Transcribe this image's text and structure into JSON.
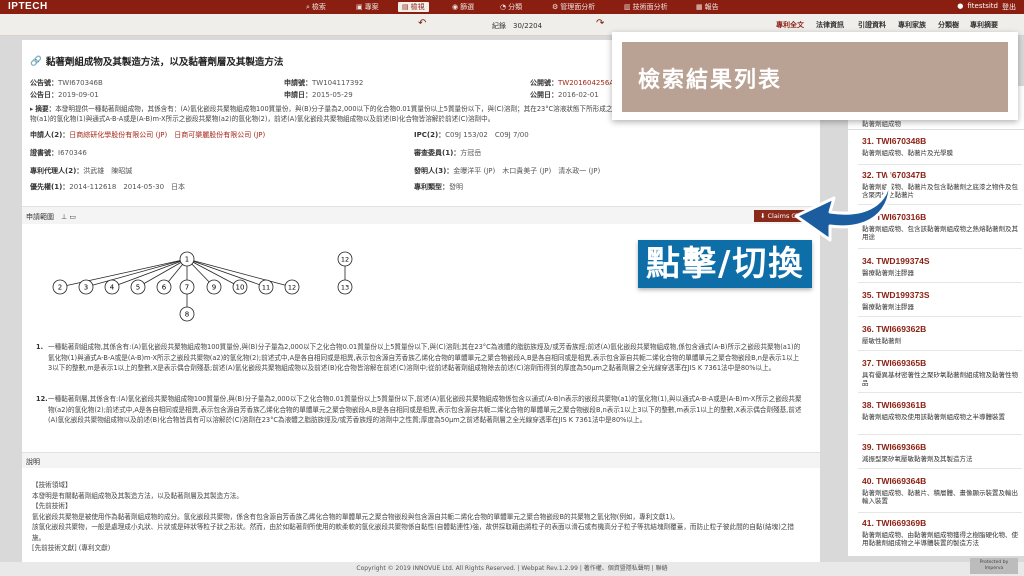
{
  "nav": {
    "logo": "IPTECH",
    "items": [
      {
        "icon": "search-icon",
        "label": "檢索"
      },
      {
        "icon": "folder-icon",
        "label": "專案"
      },
      {
        "icon": "search-icon",
        "label": "檢視"
      },
      {
        "icon": "eye-icon",
        "label": "篩選"
      },
      {
        "icon": "pie-icon",
        "label": "分類"
      },
      {
        "icon": "gear-icon",
        "label": "管理面分析"
      },
      {
        "icon": "chart-icon",
        "label": "技術面分析"
      },
      {
        "icon": "report-icon",
        "label": "報告"
      }
    ],
    "user": "fitestsitd",
    "logout": "登出"
  },
  "toolbar": {
    "record": "紀錄　30/2204",
    "tabs": [
      "專利全文",
      "法律資訊",
      "引證資料",
      "專利家族",
      "分類樹",
      "專利摘要"
    ]
  },
  "patent": {
    "title": "黏著劑組成物及其製造方法，以及黏著劑層及其製造方法",
    "fields": {
      "pub_no_lbl": "公告號：",
      "pub_no": "TWI670346B",
      "app_no_lbl": "申請號：",
      "app_no": "TW104117392",
      "open_no_lbl": "公開號：",
      "open_no": "TW201604256A",
      "pub_date_lbl": "公告日：",
      "pub_date": "2019-09-01",
      "app_date_lbl": "申請日：",
      "app_date": "2015-05-29",
      "open_date_lbl": "公開日：",
      "open_date": "2016-02-01",
      "abstract_lbl": "摘要：",
      "abstract": "本發明提供一種黏著劑組成物，其係含有：(A)氫化嵌段共聚物組成物100質量份，與(B)分子量為2,000以下的化合物0.01質量份以上5質量份以下，與(C)溶劑；其在23°C溶液狀態下所形成之黏著劑膜的嵌段共聚物組成物係包含以通式(A-B)所示之嵌段共聚物(a1)的氫化物(1)與通式A-B-A或是(A-B)m-X所示之嵌段共聚物(a2)的氫化物(2)，前述(A)氫化嵌段共聚物組成物以及前述(B)化合物皆溶解於前述(C)溶劑中。",
      "applicant_lbl": "申請人(2)：",
      "applicant": "日商綜研化學股份有限公司 (JP)　日商可樂麗股份有限公司 (JP)",
      "ipc_lbl": "IPC(2)：",
      "ipc": "C09J 153/02　C09J 7/00",
      "cert_lbl": "證書號：",
      "cert": "I670346",
      "examiner_lbl": "審查委員(1)：",
      "examiner": "方冠岳",
      "agent_lbl": "專利代理人(2)：",
      "agent": "洪武雄　陳昭誠",
      "inventor_lbl": "發明人(3)：",
      "inventor": "金曝洋平 (JP)　木口貴美子 (JP)　清水政一 (JP)",
      "priority_lbl": "優先權(1)：",
      "priority": "2014-112618　2014-05-30　日本",
      "type_lbl": "專利類型：",
      "type": "發明"
    },
    "claims_label": "申請範圍",
    "claims_chart_btn": "Claims Chart",
    "tree_nodes": [
      "1",
      "2",
      "3",
      "4",
      "5",
      "6",
      "7",
      "8",
      "9",
      "10",
      "11",
      "12",
      "13"
    ],
    "claims": [
      {
        "num": "1.",
        "text": "一種黏著劑組成物,其係含有:(A)氫化嵌段共聚物組成物100質量份,與(B)分子量為2,000以下之化合物0.01質量份以上5質量份以下,與(C)溶劑;其在23°C為液體的脂肪族烴及/或芳香族烴;前述(A)氫化嵌段共聚物組成物,係包含通式(A-B)所示之嵌段共聚物(a1)的氫化物(1)與通式A-B-A或是(A-B)m-X所示之嵌段共聚物(a2)的氫化物(2);前述式中,A是各自相同或是相異,表示包含源自芳香族乙烯化合物的單體單元之聚合物嵌段A,B是各自相同或是相異,表示包含源自共軛二烯化合物的單體單元之聚合物嵌段B,n是表示1以上3以下的整數,m是表示1以上的整數,X是表示偶合劑殘基;前述(A)氫化嵌段共聚物組成物以及前述(B)化合物皆溶解在前述(C)溶劑中;從前述黏著劑組成物除去前述(C)溶劑而得到的厚度為50μm之黏著劑層之全光線穿透率在JIS K 7361法中是80%以上。"
      },
      {
        "num": "12.",
        "text": "一種黏著劑層,其係含有:(A)氫化嵌段共聚物組成物100質量份,與(B)分子量為2,000以下之化合物0.01質量份以上5質量份以下,前述(A)氫化嵌段共聚物組成物係包含以通式(A-B)n表示的嵌段共聚物(a1)的氫化物(1),與以通式A-B-A或是(A-B)m-X所示之嵌段共聚物(a2)的氫化物(2);前述式中,A是各自相同或是相異,表示包含源自芳香族乙烯化合物的單體單元之聚合物嵌段A,B是各自相同或是相異,表示包含源自共軛二烯化合物的單體單元之聚合物嵌段B,n表示1以上3以下的整數,m表示1以上的整數,X表示偶合劑殘基,前述(A)氫化嵌段共聚物組成物以及前述(B)化合物皆具有可以溶解於(C)溶劑在23°C為液體之脂肪族烴及/或芳香族烴的溶劑中之性質;厚度為50μm之前述黏著劑層之全光線穿透率在JIS K 7361法中是80%以上。"
      }
    ],
    "desc_label": "說明",
    "desc_lines": [
      "【技術領域】",
      "本發明是有關黏著劑組成物及其製造方法，以及黏著劑層及其製造方法。",
      "【先前技術】",
      "氫化嵌段共聚物是被使用作為黏著劑組成物的成分。氫化嵌段共聚物，係含有包含源自芳香族乙烯化合物的單體單元之聚合物嵌段與包含源自共軛二烯化合物的單體單元之聚合物嵌段B的共聚物之氫化物(例如，專利文獻1)。",
      "該氫化嵌段共聚物，一般是處理成小丸狀、片狀或是碎狀等粒子狀之形狀。然而，由於如黏著劑所使用的軟柔軟的氫化嵌段共聚物係自黏性(自體黏連性)強，故併採取藉由將粒子的表面以滑石或有機高分子粒子等抗結塊劑覆蓋，而防止粒子彼此間的自黏(結塊)之措施。",
      "[先前技術文獻] (專利文獻)"
    ]
  },
  "results": {
    "header_label": "黏著劑組成物",
    "items": [
      {
        "id": "31. TWI670348B",
        "desc": "黏著劑組成物、黏著片及光學膜"
      },
      {
        "id": "32. TWI670347B",
        "desc": "黏著劑組成物、黏著片及包含黏著劑之底漆之物件及包含聚丙烯之黏著片"
      },
      {
        "id": "33. TWI670316B",
        "desc": "黏著劑組成物、包含該黏著劑組成物之熱熔黏著劑及其用途"
      },
      {
        "id": "34. TWD199374S",
        "desc": "醫療黏著劑注膠器"
      },
      {
        "id": "35. TWD199373S",
        "desc": "醫療黏著劑注膠器"
      },
      {
        "id": "36. TWI669362B",
        "desc": "壓敏性黏著劑"
      },
      {
        "id": "37. TWI669365B",
        "desc": "具有優異基材密著性之聚矽氧黏著劑組成物及黏著性物品"
      },
      {
        "id": "38. TWI669361B",
        "desc": "黏著劑組成物及使用該黏著劑組成物之半導體裝置"
      },
      {
        "id": "39. TWI669366B",
        "desc": "減振型聚矽氧壓敏黏著劑及其製造方法"
      },
      {
        "id": "40. TWI669364B",
        "desc": "黏著劑組成物、黏著片、積層體、畫像顯示裝置及輸出輸入裝置"
      },
      {
        "id": "41. TWI669369B",
        "desc": "黏著劑組成物、由黏著劑組成物獲得之樹脂硬化物、使用黏著劑組成物之半導體裝置的製造方法"
      }
    ]
  },
  "overlay": {
    "banner": "檢索結果列表",
    "callout": "點擊/切換",
    "arrow_color": "#1b5d9e"
  },
  "footer": {
    "text": "Copyright © 2019 INNOVUE Ltd. All Rights Reserved. | Webpat Rev.1.2.99 | 著作權、個資暨隱私聲明 | 聯絡",
    "badge": "Protected by Imperva"
  }
}
